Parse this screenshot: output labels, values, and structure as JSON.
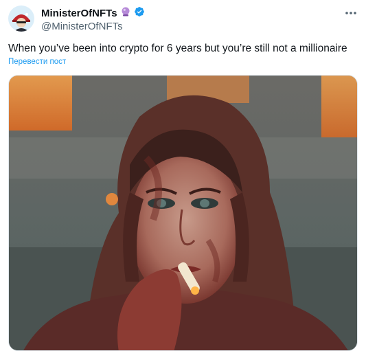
{
  "tweet": {
    "author": {
      "display_name": "MinisterOfNFTs",
      "handle": "@MinisterOfNFTs",
      "emoji_badge_icon": "crystal-ball-icon",
      "verified_icon": "verified-badge-icon",
      "verified_color": "#1d9bf0"
    },
    "text": "When you’ve been into crypto for 6 years but you’re still not a millionaire",
    "translate_label": "Перевести пост",
    "more_icon": "more-options-icon",
    "media": {
      "icon": "photo-icon"
    }
  },
  "colors": {
    "accent": "#1d9bf0",
    "text_primary": "#0f1419",
    "text_secondary": "#536471"
  }
}
